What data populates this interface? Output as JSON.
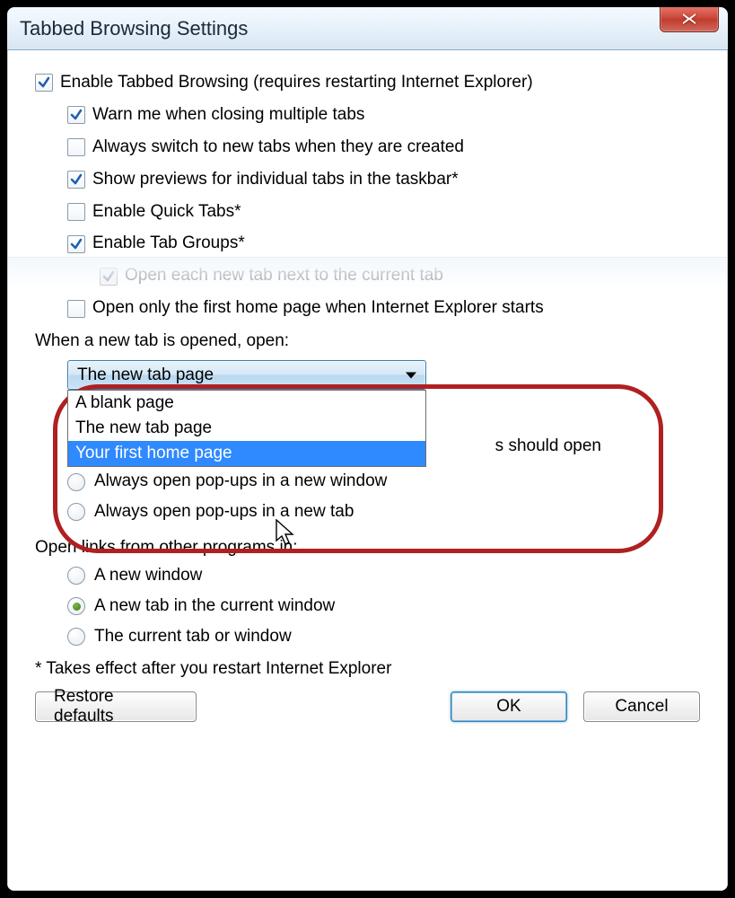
{
  "window": {
    "title": "Tabbed Browsing Settings"
  },
  "main_checkbox": {
    "label": "Enable Tabbed Browsing (requires restarting Internet Explorer)",
    "checked": true
  },
  "sub_checkboxes": [
    {
      "label": "Warn me when closing multiple tabs",
      "checked": true,
      "disabled": false
    },
    {
      "label": "Always switch to new tabs when they are created",
      "checked": false,
      "disabled": false
    },
    {
      "label": "Show previews for individual tabs in the taskbar*",
      "checked": true,
      "disabled": false
    },
    {
      "label": "Enable Quick Tabs*",
      "checked": false,
      "disabled": false
    },
    {
      "label": "Enable Tab Groups*",
      "checked": true,
      "disabled": false
    }
  ],
  "subsub_checkbox": {
    "label": "Open each new tab next to the current tab",
    "checked": true,
    "disabled": true
  },
  "sub_checkbox_after": {
    "label": "Open only the first home page when Internet Explorer starts",
    "checked": false,
    "disabled": false
  },
  "new_tab_section": {
    "label": "When a new tab is opened, open:",
    "selected": "The new tab page",
    "options": [
      "A blank page",
      "The new tab page",
      "Your first home page"
    ],
    "highlighted_index": 2
  },
  "popup_section": {
    "label_partial_suffix": "s should open",
    "options": [
      {
        "label": "Always open pop-ups in a new window",
        "checked": false
      },
      {
        "label": "Always open pop-ups in a new tab",
        "checked": false
      }
    ]
  },
  "links_section": {
    "label": "Open links from other programs in:",
    "options": [
      {
        "label": "A new window",
        "checked": false
      },
      {
        "label": "A new tab in the current window",
        "checked": true
      },
      {
        "label": "The current tab or window",
        "checked": false
      }
    ]
  },
  "footnote": "* Takes effect after you restart Internet Explorer",
  "buttons": {
    "restore": "Restore defaults",
    "ok": "OK",
    "cancel": "Cancel"
  }
}
